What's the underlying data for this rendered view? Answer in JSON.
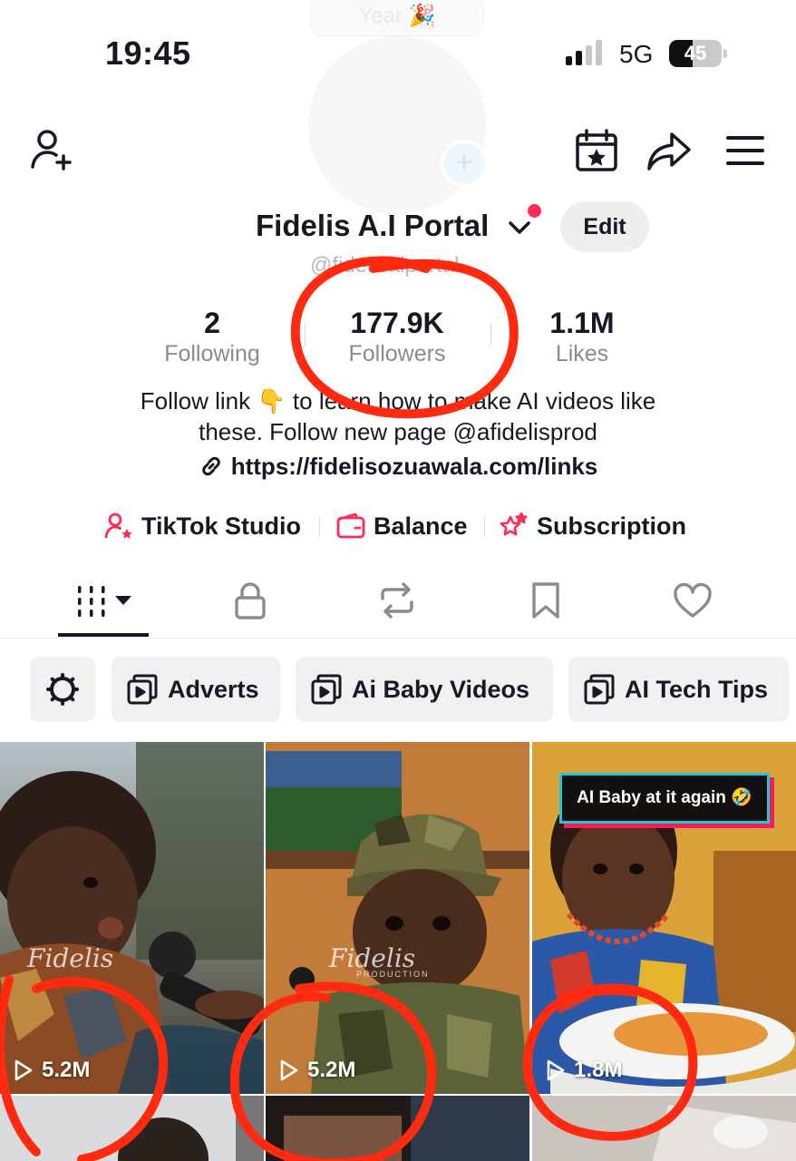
{
  "status_bar": {
    "time": "19:45",
    "network": "5G",
    "battery": "45",
    "battery_level": 0.45
  },
  "banner": {
    "year_text": "Year 🎉"
  },
  "profile": {
    "name": "Fidelis A.I Portal",
    "handle": "@fidelisaiportal",
    "edit_label": "Edit",
    "stats": [
      {
        "value": "2",
        "label": "Following"
      },
      {
        "value": "177.9K",
        "label": "Followers"
      },
      {
        "value": "1.1M",
        "label": "Likes"
      }
    ],
    "bio_line1": "Follow link 👇 to learn how to make AI videos like",
    "bio_line2": "these. Follow new page @afidelisprod",
    "link": "https://fidelisozuawala.com/links"
  },
  "tools": [
    {
      "label": "TikTok Studio",
      "icon": "person-star-icon"
    },
    {
      "label": "Balance",
      "icon": "wallet-icon"
    },
    {
      "label": "Subscription",
      "icon": "stars-icon"
    }
  ],
  "tabs": [
    "videos-grid-icon",
    "lock-icon",
    "repost-icon",
    "bookmark-icon",
    "heart-icon"
  ],
  "collections": [
    {
      "label": "Adverts"
    },
    {
      "label": "Ai Baby Videos"
    },
    {
      "label": "AI Tech Tips"
    }
  ],
  "videos": [
    {
      "views": "5.2M",
      "watermark": "Fidelis"
    },
    {
      "views": "5.2M",
      "watermark": "Fidelis",
      "watermark_sub": "PRODUCTION"
    },
    {
      "views": "1.8M",
      "caption": "AI Baby at it again 🤣"
    }
  ],
  "colors": {
    "accent": "#fe2c55",
    "annotation": "#ff2a10"
  }
}
